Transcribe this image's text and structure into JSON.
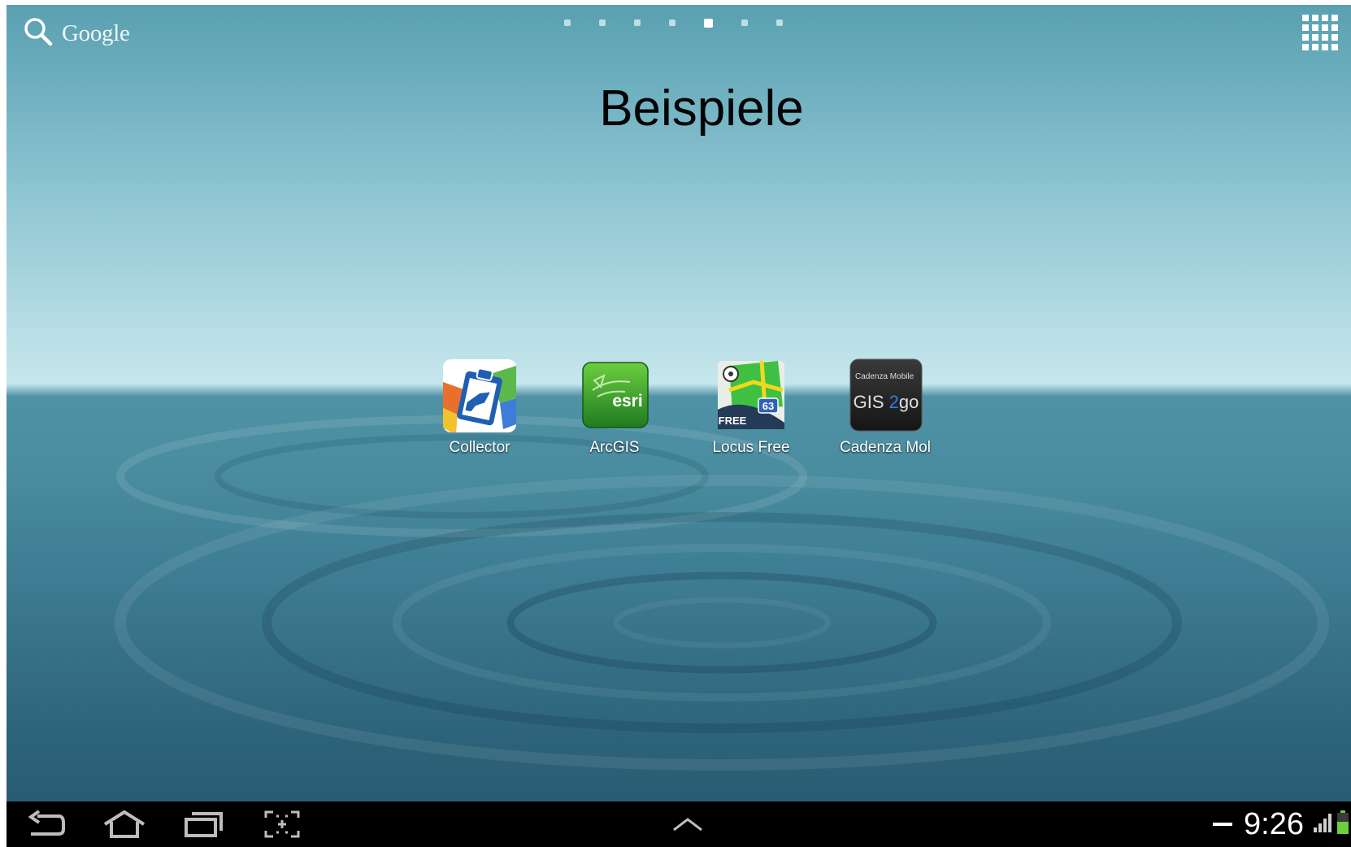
{
  "topbar": {
    "search_label": "Google",
    "page_count": 7,
    "active_page": 5
  },
  "folder": {
    "title": "Beispiele"
  },
  "apps": [
    {
      "label": "Collector",
      "icon": "collector-clipboard-icon"
    },
    {
      "label": "ArcGIS",
      "icon": "esri-arcgis-icon"
    },
    {
      "label": "Locus Free",
      "icon": "locus-map-icon"
    },
    {
      "label": "Cadenza Mol",
      "icon": "cadenza-gis2go-icon"
    }
  ],
  "icon_text": {
    "arcgis": "esri",
    "locus_badge": "FREE",
    "locus_route": "63",
    "cadenza_small": "Cadenza Mobile",
    "cadenza_main": "GIS 2go"
  },
  "navbar": {
    "back_icon": "back-arrow-icon",
    "home_icon": "home-icon",
    "recents_icon": "recent-apps-icon",
    "screenshot_icon": "screen-capture-icon",
    "up_icon": "chevron-up-icon",
    "time": "9:26"
  },
  "colors": {
    "sky_top": "#5aa0b1",
    "horizon": "#c5e6ec",
    "water": "#3f7f95",
    "navbar": "#000000",
    "battery": "#6ccf3f"
  }
}
